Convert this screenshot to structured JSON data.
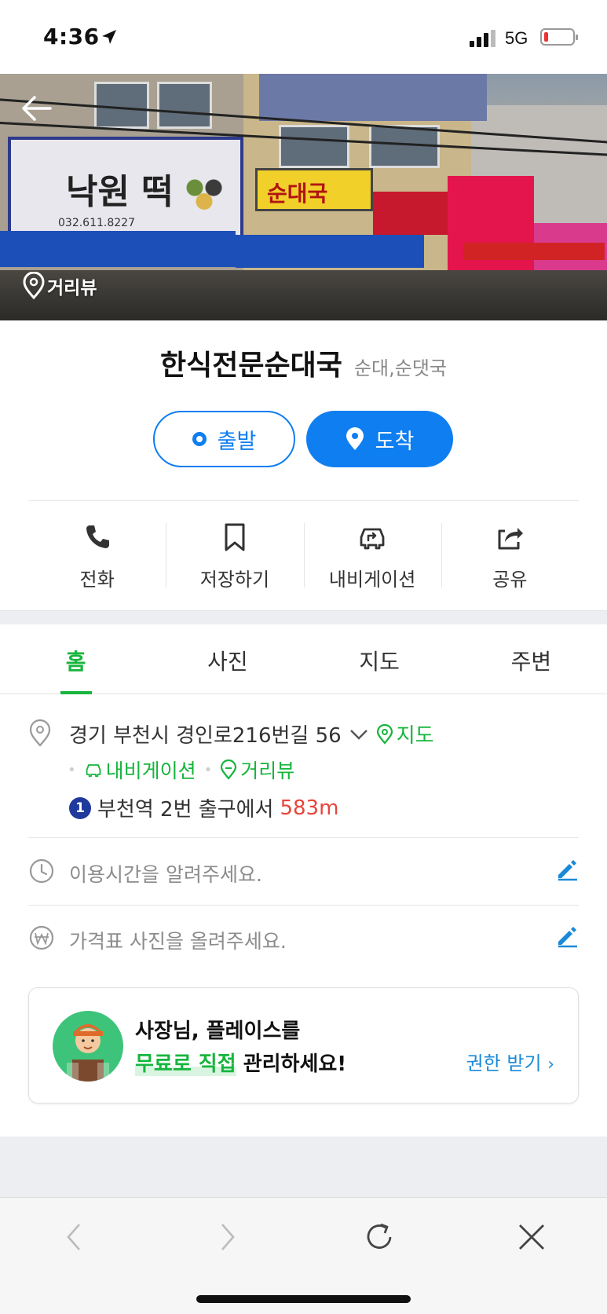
{
  "status_bar": {
    "time": "4:36",
    "network": "5G"
  },
  "hero": {
    "street_view_label": "거리뷰"
  },
  "place": {
    "name": "한식전문순대국",
    "category": "순대,순댓국"
  },
  "route": {
    "depart_label": "출발",
    "arrive_label": "도착"
  },
  "actions": [
    {
      "label": "전화",
      "icon": "phone-icon"
    },
    {
      "label": "저장하기",
      "icon": "bookmark-icon"
    },
    {
      "label": "내비게이션",
      "icon": "navigation-car-icon"
    },
    {
      "label": "공유",
      "icon": "share-icon"
    }
  ],
  "tabs": [
    {
      "label": "홈",
      "active": true
    },
    {
      "label": "사진",
      "active": false
    },
    {
      "label": "지도",
      "active": false
    },
    {
      "label": "주변",
      "active": false
    }
  ],
  "address": {
    "text": "경기 부천시 경인로216번길 56",
    "map_link": "지도",
    "navigation_link": "내비게이션",
    "street_view_link": "거리뷰",
    "subway_line": "1",
    "subway_text": "부천역 2번 출구에서",
    "distance": "583m"
  },
  "hours_prompt": "이용시간을 알려주세요.",
  "price_prompt": "가격표 사진을 올려주세요.",
  "owner_banner": {
    "line1": "사장님, 플레이스를",
    "line2_highlight": "무료로 직접",
    "line2_rest": " 관리하세요!",
    "cta": "권한 받기"
  },
  "colors": {
    "accent_blue": "#0f7ef0",
    "accent_green": "#17b53d",
    "distance_red": "#e8453c"
  }
}
